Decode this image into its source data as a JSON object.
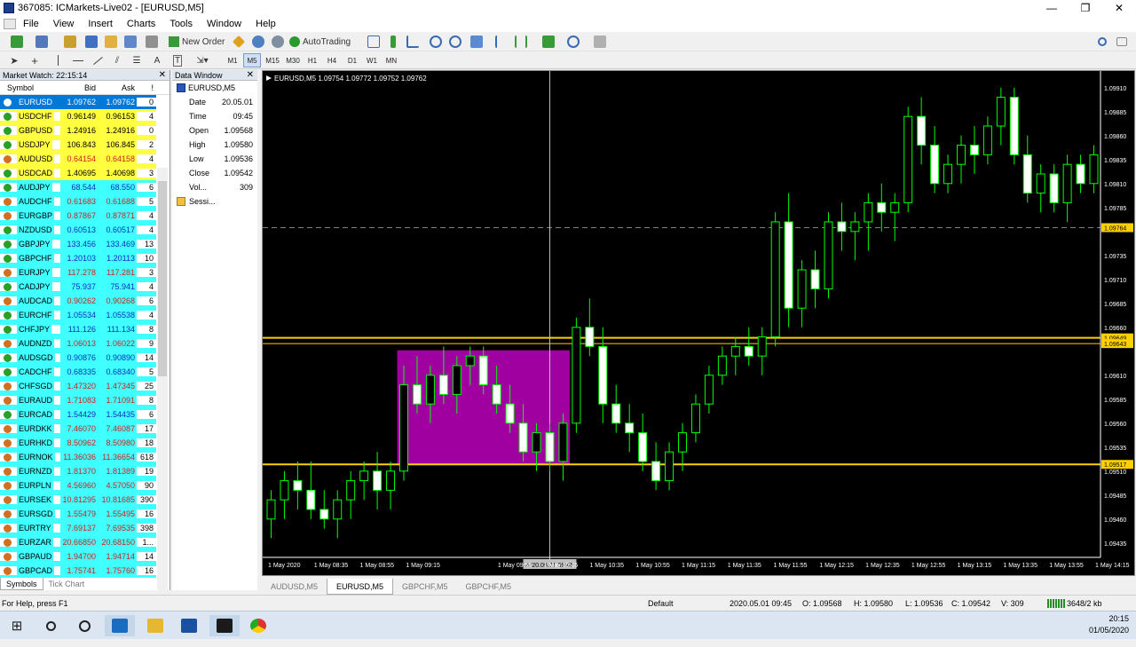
{
  "window": {
    "title": "367085: ICMarkets-Live02 - [EURUSD,M5]"
  },
  "menu": [
    "File",
    "View",
    "Insert",
    "Charts",
    "Tools",
    "Window",
    "Help"
  ],
  "toolbar": {
    "new_order": "New Order",
    "auto_trading": "AutoTrading"
  },
  "timeframes": [
    "M1",
    "M5",
    "M15",
    "M30",
    "H1",
    "H4",
    "D1",
    "W1",
    "MN"
  ],
  "active_timeframe": "M5",
  "market_watch": {
    "title": "Market Watch: 22:15:14",
    "columns": {
      "symbol": "Symbol",
      "bid": "Bid",
      "ask": "Ask",
      "spread": "!"
    },
    "rows": [
      {
        "symbol": "EURUSD",
        "bid": "1.09762",
        "ask": "1.09762",
        "spread": "0",
        "bg": "#0078d7",
        "fg": "#ffffff",
        "dot": "#ffffff"
      },
      {
        "symbol": "USDCHF",
        "bid": "0.96149",
        "ask": "0.96153",
        "spread": "4",
        "bg": "#ffff40",
        "fg": "#000000",
        "dot": "#28a028"
      },
      {
        "symbol": "GBPUSD",
        "bid": "1.24916",
        "ask": "1.24916",
        "spread": "0",
        "bg": "#ffff40",
        "fg": "#000000",
        "dot": "#28a028"
      },
      {
        "symbol": "USDJPY",
        "bid": "106.843",
        "ask": "106.845",
        "spread": "2",
        "bg": "#ffff40",
        "fg": "#000000",
        "dot": "#28a028"
      },
      {
        "symbol": "AUDUSD",
        "bid": "0.64154",
        "ask": "0.64158",
        "spread": "4",
        "bg": "#ffff40",
        "fg": "#d02020",
        "dot": "#d07020"
      },
      {
        "symbol": "USDCAD",
        "bid": "1.40695",
        "ask": "1.40698",
        "spread": "3",
        "bg": "#ffff40",
        "fg": "#000000",
        "dot": "#28a028"
      },
      {
        "symbol": "AUDJPY",
        "bid": "68.544",
        "ask": "68.550",
        "spread": "6",
        "bg": "#40ffff",
        "fg": "#1030c0",
        "dot": "#28a028"
      },
      {
        "symbol": "AUDCHF",
        "bid": "0.61683",
        "ask": "0.61688",
        "spread": "5",
        "bg": "#40ffff",
        "fg": "#d02020",
        "dot": "#d07020"
      },
      {
        "symbol": "EURGBP",
        "bid": "0.87867",
        "ask": "0.87871",
        "spread": "4",
        "bg": "#40ffff",
        "fg": "#d02020",
        "dot": "#d07020"
      },
      {
        "symbol": "NZDUSD",
        "bid": "0.60513",
        "ask": "0.60517",
        "spread": "4",
        "bg": "#40ffff",
        "fg": "#1030c0",
        "dot": "#28a028"
      },
      {
        "symbol": "GBPJPY",
        "bid": "133.456",
        "ask": "133.469",
        "spread": "13",
        "bg": "#40ffff",
        "fg": "#1030c0",
        "dot": "#28a028"
      },
      {
        "symbol": "GBPCHF",
        "bid": "1.20103",
        "ask": "1.20113",
        "spread": "10",
        "bg": "#40ffff",
        "fg": "#1030c0",
        "dot": "#28a028"
      },
      {
        "symbol": "EURJPY",
        "bid": "117.278",
        "ask": "117.281",
        "spread": "3",
        "bg": "#40ffff",
        "fg": "#d02020",
        "dot": "#d07020"
      },
      {
        "symbol": "CADJPY",
        "bid": "75.937",
        "ask": "75.941",
        "spread": "4",
        "bg": "#40ffff",
        "fg": "#1030c0",
        "dot": "#28a028"
      },
      {
        "symbol": "AUDCAD",
        "bid": "0.90262",
        "ask": "0.90268",
        "spread": "6",
        "bg": "#40ffff",
        "fg": "#d02020",
        "dot": "#d07020"
      },
      {
        "symbol": "EURCHF",
        "bid": "1.05534",
        "ask": "1.05538",
        "spread": "4",
        "bg": "#40ffff",
        "fg": "#1030c0",
        "dot": "#28a028"
      },
      {
        "symbol": "CHFJPY",
        "bid": "111.126",
        "ask": "111.134",
        "spread": "8",
        "bg": "#40ffff",
        "fg": "#1030c0",
        "dot": "#28a028"
      },
      {
        "symbol": "AUDNZD",
        "bid": "1.06013",
        "ask": "1.06022",
        "spread": "9",
        "bg": "#40ffff",
        "fg": "#d02020",
        "dot": "#d07020"
      },
      {
        "symbol": "AUDSGD",
        "bid": "0.90876",
        "ask": "0.90890",
        "spread": "14",
        "bg": "#40ffff",
        "fg": "#1030c0",
        "dot": "#28a028"
      },
      {
        "symbol": "CADCHF",
        "bid": "0.68335",
        "ask": "0.68340",
        "spread": "5",
        "bg": "#40ffff",
        "fg": "#1030c0",
        "dot": "#28a028"
      },
      {
        "symbol": "CHFSGD",
        "bid": "1.47320",
        "ask": "1.47345",
        "spread": "25",
        "bg": "#40ffff",
        "fg": "#d02020",
        "dot": "#d07020"
      },
      {
        "symbol": "EURAUD",
        "bid": "1.71083",
        "ask": "1.71091",
        "spread": "8",
        "bg": "#40ffff",
        "fg": "#d02020",
        "dot": "#d07020"
      },
      {
        "symbol": "EURCAD",
        "bid": "1.54429",
        "ask": "1.54435",
        "spread": "6",
        "bg": "#40ffff",
        "fg": "#1030c0",
        "dot": "#28a028"
      },
      {
        "symbol": "EURDKK",
        "bid": "7.46070",
        "ask": "7.46087",
        "spread": "17",
        "bg": "#40ffff",
        "fg": "#d02020",
        "dot": "#d07020"
      },
      {
        "symbol": "EURHKD",
        "bid": "8.50962",
        "ask": "8.50980",
        "spread": "18",
        "bg": "#40ffff",
        "fg": "#d02020",
        "dot": "#d07020"
      },
      {
        "symbol": "EURNOK",
        "bid": "11.36036",
        "ask": "11.36654",
        "spread": "618",
        "bg": "#40ffff",
        "fg": "#d02020",
        "dot": "#d07020"
      },
      {
        "symbol": "EURNZD",
        "bid": "1.81370",
        "ask": "1.81389",
        "spread": "19",
        "bg": "#40ffff",
        "fg": "#d02020",
        "dot": "#d07020"
      },
      {
        "symbol": "EURPLN",
        "bid": "4.56960",
        "ask": "4.57050",
        "spread": "90",
        "bg": "#40ffff",
        "fg": "#d02020",
        "dot": "#d07020"
      },
      {
        "symbol": "EURSEK",
        "bid": "10.81295",
        "ask": "10.81685",
        "spread": "390",
        "bg": "#40ffff",
        "fg": "#d02020",
        "dot": "#d07020"
      },
      {
        "symbol": "EURSGD",
        "bid": "1.55479",
        "ask": "1.55495",
        "spread": "16",
        "bg": "#40ffff",
        "fg": "#d02020",
        "dot": "#d07020"
      },
      {
        "symbol": "EURTRY",
        "bid": "7.69137",
        "ask": "7.69535",
        "spread": "398",
        "bg": "#40ffff",
        "fg": "#d02020",
        "dot": "#d07020"
      },
      {
        "symbol": "EURZAR",
        "bid": "20.66850",
        "ask": "20.68150",
        "spread": "1...",
        "bg": "#40ffff",
        "fg": "#d02020",
        "dot": "#d07020"
      },
      {
        "symbol": "GBPAUD",
        "bid": "1.94700",
        "ask": "1.94714",
        "spread": "14",
        "bg": "#40ffff",
        "fg": "#d02020",
        "dot": "#d07020"
      },
      {
        "symbol": "GBPCAD",
        "bid": "1.75741",
        "ask": "1.75760",
        "spread": "16",
        "bg": "#40ffff",
        "fg": "#d02020",
        "dot": "#d07020"
      }
    ],
    "tabs": [
      "Symbols",
      "Tick Chart"
    ]
  },
  "data_window": {
    "title": "Data Window",
    "symbol": "EURUSD,M5",
    "rows": [
      {
        "label": "Date",
        "value": "20.05.01"
      },
      {
        "label": "Time",
        "value": "09:45"
      },
      {
        "label": "Open",
        "value": "1.09568"
      },
      {
        "label": "High",
        "value": "1.09580"
      },
      {
        "label": "Low",
        "value": "1.09536"
      },
      {
        "label": "Close",
        "value": "1.09542"
      },
      {
        "label": "Vol...",
        "value": "309"
      }
    ],
    "sessions": "Sessi..."
  },
  "chart_info": "EURUSD,M5  1.09754 1.09772 1.09752 1.09762",
  "price_labels": [
    "1.09910",
    "1.09885",
    "1.09860",
    "1.09835",
    "1.09810",
    "1.09785",
    "1.09764",
    "1.09735",
    "1.09710",
    "1.09685",
    "1.09660",
    "1.09649",
    "1.09643",
    "1.09610",
    "1.09585",
    "1.09560",
    "1.09535",
    "1.09517",
    "1.09510",
    "1.09485",
    "1.09460",
    "1.09435"
  ],
  "time_labels": [
    "1 May 2020",
    "1 May 08:35",
    "1 May 08:55",
    "1 May 09:15",
    "2020.05.01 09:45",
    "1 May 09:55",
    "1 May 10:15",
    "1 May 10:35",
    "1 May 10:55",
    "1 May 11:15",
    "1 May 11:35",
    "1 May 11:55",
    "1 May 12:15",
    "1 May 12:35",
    "1 May 12:55",
    "1 May 13:15",
    "1 May 13:35",
    "1 May 13:55",
    "1 May 14:15"
  ],
  "chart_tabs": [
    "AUDUSD,M5",
    "EURUSD,M5",
    "GBPCHF,M5",
    "GBPCHF,M5"
  ],
  "active_chart_tab": "EURUSD,M5",
  "status": {
    "help": "For Help, press F1",
    "profile": "Default",
    "datetime": "2020.05.01 09:45",
    "open": "O: 1.09568",
    "high": "H: 1.09580",
    "low": "L: 1.09536",
    "close": "C: 1.09542",
    "volume": "V: 309",
    "traffic": "3648/2 kb"
  },
  "taskbar": {
    "time": "20:15",
    "date": "01/05/2020"
  },
  "colors": {
    "candle_stroke": "#00ff00",
    "bull": "#000000",
    "bear": "#ffffff",
    "level_line": "#ffd000",
    "zone": "#a000a0",
    "bid_line": "#808080",
    "bid_tag": "#ffd000"
  },
  "chart_data": {
    "type": "candlestick",
    "ylim": [
      1.0942,
      1.0992
    ],
    "bid": 1.09764,
    "levels": [
      1.09649,
      1.09643,
      1.09517
    ],
    "zone": {
      "x_start": 10,
      "x_end": 23,
      "top": 1.09636,
      "bottom": 1.09517
    },
    "crosshair_index": 21,
    "candles": [
      [
        1.0946,
        1.0949,
        1.0944,
        1.0948
      ],
      [
        1.0948,
        1.0951,
        1.0946,
        1.095
      ],
      [
        1.095,
        1.0952,
        1.0947,
        1.0949
      ],
      [
        1.0949,
        1.0952,
        1.0946,
        1.0947
      ],
      [
        1.0947,
        1.0949,
        1.0945,
        1.0946
      ],
      [
        1.0946,
        1.0949,
        1.0944,
        1.0948
      ],
      [
        1.0948,
        1.0951,
        1.0946,
        1.095
      ],
      [
        1.095,
        1.0952,
        1.0948,
        1.0951
      ],
      [
        1.0951,
        1.0953,
        1.0947,
        1.0949
      ],
      [
        1.0949,
        1.0952,
        1.0947,
        1.0951
      ],
      [
        1.0951,
        1.0962,
        1.095,
        1.096
      ],
      [
        1.096,
        1.0963,
        1.0957,
        1.0958
      ],
      [
        1.0958,
        1.0962,
        1.0956,
        1.0961
      ],
      [
        1.0961,
        1.0964,
        1.0958,
        1.0959
      ],
      [
        1.0959,
        1.0963,
        1.0957,
        1.0962
      ],
      [
        1.0962,
        1.0964,
        1.096,
        1.0963
      ],
      [
        1.0963,
        1.0964,
        1.0959,
        1.096
      ],
      [
        1.096,
        1.0962,
        1.0957,
        1.0958
      ],
      [
        1.0958,
        1.096,
        1.0955,
        1.0956
      ],
      [
        1.0956,
        1.0958,
        1.0952,
        1.0953
      ],
      [
        1.0953,
        1.0956,
        1.0951,
        1.0955
      ],
      [
        1.0955,
        1.0956,
        1.0951,
        1.0952
      ],
      [
        1.0952,
        1.0957,
        1.095,
        1.0956
      ],
      [
        1.0956,
        1.0967,
        1.0955,
        1.0966
      ],
      [
        1.0966,
        1.0969,
        1.0963,
        1.0964
      ],
      [
        1.0964,
        1.0966,
        1.0956,
        1.0958
      ],
      [
        1.0958,
        1.096,
        1.0955,
        1.0956
      ],
      [
        1.0956,
        1.0958,
        1.0953,
        1.0955
      ],
      [
        1.0955,
        1.0957,
        1.0951,
        1.0952
      ],
      [
        1.0952,
        1.0954,
        1.0949,
        1.095
      ],
      [
        1.095,
        1.0954,
        1.0949,
        1.0953
      ],
      [
        1.0953,
        1.0956,
        1.0951,
        1.0955
      ],
      [
        1.0955,
        1.0959,
        1.0954,
        1.0958
      ],
      [
        1.0958,
        1.0962,
        1.0957,
        1.0961
      ],
      [
        1.0961,
        1.0964,
        1.096,
        1.0963
      ],
      [
        1.0963,
        1.0965,
        1.0961,
        1.0964
      ],
      [
        1.0964,
        1.0966,
        1.0962,
        1.0963
      ],
      [
        1.0963,
        1.0966,
        1.0961,
        1.0965
      ],
      [
        1.0965,
        1.0978,
        1.0964,
        1.0977
      ],
      [
        1.0977,
        1.098,
        1.0966,
        1.0968
      ],
      [
        1.0968,
        1.0973,
        1.0966,
        1.0972
      ],
      [
        1.0972,
        1.0974,
        1.0968,
        1.097
      ],
      [
        1.097,
        1.0978,
        1.0969,
        1.0977
      ],
      [
        1.0977,
        1.0979,
        1.0974,
        1.0976
      ],
      [
        1.0976,
        1.0978,
        1.0973,
        1.0977
      ],
      [
        1.0977,
        1.098,
        1.0974,
        1.0979
      ],
      [
        1.0979,
        1.0981,
        1.0976,
        1.0978
      ],
      [
        1.0978,
        1.098,
        1.0975,
        1.0979
      ],
      [
        1.0979,
        1.0989,
        1.0978,
        1.0988
      ],
      [
        1.0988,
        1.099,
        1.0983,
        1.0985
      ],
      [
        1.0985,
        1.0987,
        1.098,
        1.0981
      ],
      [
        1.0981,
        1.0984,
        1.098,
        1.0983
      ],
      [
        1.0983,
        1.0986,
        1.0981,
        1.0985
      ],
      [
        1.0985,
        1.0987,
        1.0982,
        1.0984
      ],
      [
        1.0984,
        1.0988,
        1.0983,
        1.0987
      ],
      [
        1.0987,
        1.0991,
        1.0985,
        1.099
      ],
      [
        1.099,
        1.0991,
        1.0983,
        1.0984
      ],
      [
        1.0984,
        1.0986,
        1.0979,
        1.098
      ],
      [
        1.098,
        1.0983,
        1.0978,
        1.0982
      ],
      [
        1.0982,
        1.0983,
        1.0978,
        1.0979
      ],
      [
        1.0979,
        1.0984,
        1.0977,
        1.0983
      ],
      [
        1.0983,
        1.0984,
        1.098,
        1.0981
      ],
      [
        1.0981,
        1.0985,
        1.098,
        1.0984
      ]
    ]
  }
}
